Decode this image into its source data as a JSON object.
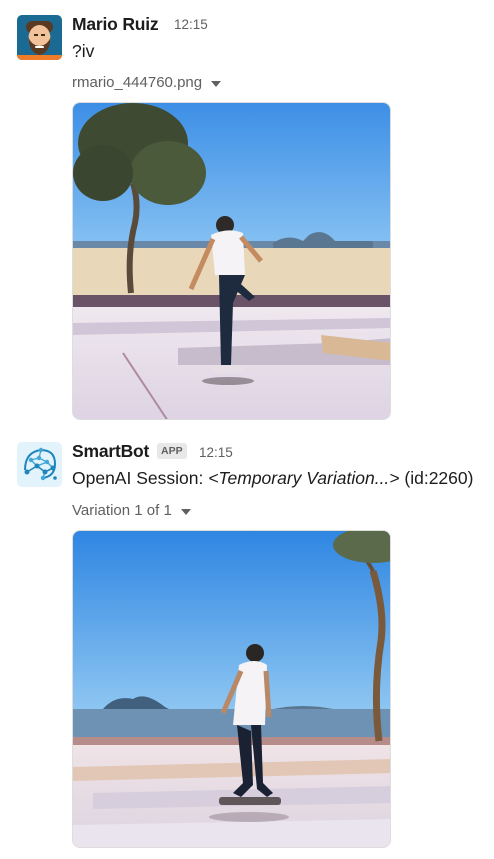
{
  "messages": [
    {
      "author": "Mario Ruiz",
      "time": "12:15",
      "text": "?iv",
      "file_name": "rmario_444760.png",
      "avatar_icon": "bearded-man-avatar-icon",
      "image_alt": "skateboarder photo"
    },
    {
      "author": "SmartBot",
      "badge": "APP",
      "time": "12:15",
      "text_prefix": "OpenAI Session: ",
      "text_italic": "<Temporary Variation...>",
      "text_suffix": " (id:2260)",
      "file_name": "Variation 1 of 1",
      "avatar_icon": "network-brain-icon",
      "image_alt": "skateboarder variation photo"
    }
  ],
  "colors": {
    "avatar_bg": "#1d6fa3",
    "sky": "#4a9be8",
    "ground": "#e9e4ef"
  }
}
